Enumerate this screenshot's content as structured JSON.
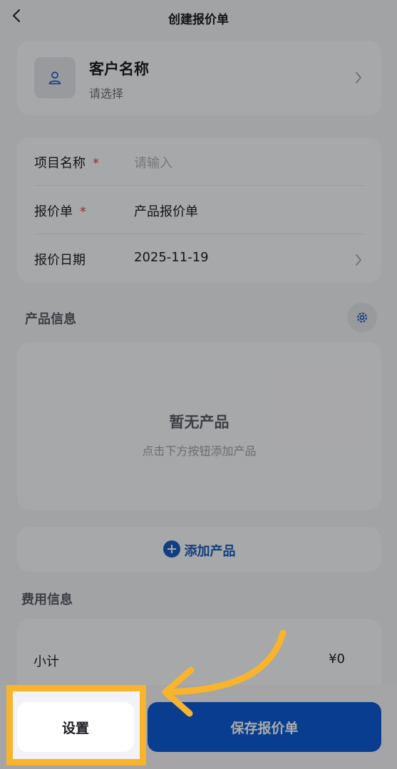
{
  "header": {
    "title": "创建报价单",
    "back_icon": "chevron-left-icon"
  },
  "customer": {
    "name_label": "客户名称",
    "sub_label": "请选择",
    "icon": "user-icon"
  },
  "form": {
    "project": {
      "label": "项目名称",
      "required_mark": "*",
      "placeholder": "请输入"
    },
    "quote": {
      "label": "报价单",
      "required_mark": "*",
      "value": "产品报价单"
    },
    "date": {
      "label": "报价日期",
      "value": "2025-11-19"
    }
  },
  "products": {
    "section_title": "产品信息",
    "empty_title": "暂无产品",
    "empty_sub": "点击下方按钮添加产品",
    "add_label": "添加产品"
  },
  "costs": {
    "section_title": "费用信息",
    "subtotal_label": "小计",
    "subtotal_value": "¥0"
  },
  "footer": {
    "settings_label": "设置",
    "save_label": "保存报价单"
  },
  "colors": {
    "accent": "#0d5bd6",
    "highlight": "#f7b42c",
    "required": "#e04b4b"
  }
}
